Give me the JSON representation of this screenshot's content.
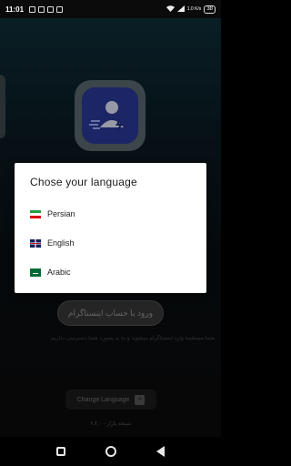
{
  "status_bar": {
    "time": "11:01",
    "net_speed": "1.0 K/s",
    "battery": "38"
  },
  "background": {
    "login_button_label": "ورود با حساب اینستاگرام",
    "login_note": "شما مستقیما وارد اینستاگرام میشوید و ما به پسورد شما دسترسی نداریم",
    "change_language_label": "Change Language",
    "version_text": "نسخه بازار - ۶.۳.۰"
  },
  "dialog": {
    "title": "Chose your language",
    "options": [
      {
        "label": "Persian",
        "flag": "iran-flag"
      },
      {
        "label": "English",
        "flag": "uk-flag"
      },
      {
        "label": "Arabic",
        "flag": "saudi-flag"
      }
    ]
  },
  "colors": {
    "dialog_bg": "#ffffff",
    "logo_accent": "#2b3a9c",
    "background_top": "#0e2f39"
  }
}
